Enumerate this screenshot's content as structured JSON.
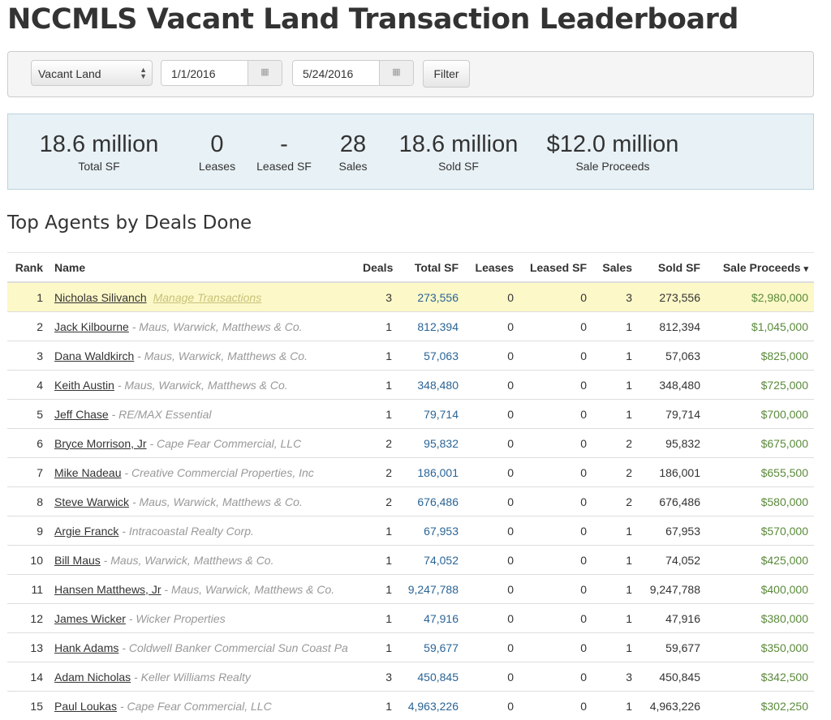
{
  "title": "NCCMLS Vacant Land Transaction Leaderboard",
  "filters": {
    "property_type": "Vacant Land",
    "start_date": "1/1/2016",
    "end_date": "5/24/2016",
    "filter_label": "Filter",
    "calendar_icon": "calendar-icon"
  },
  "stats": [
    {
      "value": "18.6 million",
      "label": "Total SF"
    },
    {
      "value": "0",
      "label": "Leases"
    },
    {
      "value": "-",
      "label": "Leased SF"
    },
    {
      "value": "28",
      "label": "Sales"
    },
    {
      "value": "18.6 million",
      "label": "Sold SF"
    },
    {
      "value": "$12.0 million",
      "label": "Sale Proceeds"
    }
  ],
  "section_title": "Top Agents by Deals Done",
  "table": {
    "headers": [
      "Rank",
      "Name",
      "Deals",
      "Total SF",
      "Leases",
      "Leased SF",
      "Sales",
      "Sold SF",
      "Sale Proceeds"
    ],
    "sort_indicator": "▾",
    "rows": [
      {
        "rank": "1",
        "name": "Nicholas Silivanch",
        "firm": "",
        "manage": "Manage Transactions",
        "deals": "3",
        "total_sf": "273,556",
        "leases": "0",
        "leased_sf": "0",
        "sales": "3",
        "sold_sf": "273,556",
        "proceeds": "$2,980,000"
      },
      {
        "rank": "2",
        "name": "Jack Kilbourne",
        "firm": "Maus, Warwick, Matthews & Co.",
        "deals": "1",
        "total_sf": "812,394",
        "leases": "0",
        "leased_sf": "0",
        "sales": "1",
        "sold_sf": "812,394",
        "proceeds": "$1,045,000"
      },
      {
        "rank": "3",
        "name": "Dana Waldkirch",
        "firm": "Maus, Warwick, Matthews & Co.",
        "deals": "1",
        "total_sf": "57,063",
        "leases": "0",
        "leased_sf": "0",
        "sales": "1",
        "sold_sf": "57,063",
        "proceeds": "$825,000"
      },
      {
        "rank": "4",
        "name": "Keith Austin",
        "firm": "Maus, Warwick, Matthews & Co.",
        "deals": "1",
        "total_sf": "348,480",
        "leases": "0",
        "leased_sf": "0",
        "sales": "1",
        "sold_sf": "348,480",
        "proceeds": "$725,000"
      },
      {
        "rank": "5",
        "name": "Jeff Chase",
        "firm": "RE/MAX Essential",
        "deals": "1",
        "total_sf": "79,714",
        "leases": "0",
        "leased_sf": "0",
        "sales": "1",
        "sold_sf": "79,714",
        "proceeds": "$700,000"
      },
      {
        "rank": "6",
        "name": "Bryce Morrison, Jr",
        "firm": "Cape Fear Commercial, LLC",
        "deals": "2",
        "total_sf": "95,832",
        "leases": "0",
        "leased_sf": "0",
        "sales": "2",
        "sold_sf": "95,832",
        "proceeds": "$675,000"
      },
      {
        "rank": "7",
        "name": "Mike Nadeau",
        "firm": "Creative Commercial Properties, Inc",
        "deals": "2",
        "total_sf": "186,001",
        "leases": "0",
        "leased_sf": "0",
        "sales": "2",
        "sold_sf": "186,001",
        "proceeds": "$655,500"
      },
      {
        "rank": "8",
        "name": "Steve Warwick",
        "firm": "Maus, Warwick, Matthews & Co.",
        "deals": "2",
        "total_sf": "676,486",
        "leases": "0",
        "leased_sf": "0",
        "sales": "2",
        "sold_sf": "676,486",
        "proceeds": "$580,000"
      },
      {
        "rank": "9",
        "name": "Argie Franck",
        "firm": "Intracoastal Realty Corp.",
        "deals": "1",
        "total_sf": "67,953",
        "leases": "0",
        "leased_sf": "0",
        "sales": "1",
        "sold_sf": "67,953",
        "proceeds": "$570,000"
      },
      {
        "rank": "10",
        "name": "Bill Maus",
        "firm": "Maus, Warwick, Matthews & Co.",
        "deals": "1",
        "total_sf": "74,052",
        "leases": "0",
        "leased_sf": "0",
        "sales": "1",
        "sold_sf": "74,052",
        "proceeds": "$425,000"
      },
      {
        "rank": "11",
        "name": "Hansen Matthews, Jr",
        "firm": "Maus, Warwick, Matthews & Co.",
        "deals": "1",
        "total_sf": "9,247,788",
        "leases": "0",
        "leased_sf": "0",
        "sales": "1",
        "sold_sf": "9,247,788",
        "proceeds": "$400,000"
      },
      {
        "rank": "12",
        "name": "James Wicker",
        "firm": "Wicker Properties",
        "deals": "1",
        "total_sf": "47,916",
        "leases": "0",
        "leased_sf": "0",
        "sales": "1",
        "sold_sf": "47,916",
        "proceeds": "$380,000"
      },
      {
        "rank": "13",
        "name": "Hank Adams",
        "firm": "Coldwell Banker Commercial Sun Coast Pa",
        "deals": "1",
        "total_sf": "59,677",
        "leases": "0",
        "leased_sf": "0",
        "sales": "1",
        "sold_sf": "59,677",
        "proceeds": "$350,000"
      },
      {
        "rank": "14",
        "name": "Adam Nicholas",
        "firm": "Keller Williams Realty",
        "deals": "3",
        "total_sf": "450,845",
        "leases": "0",
        "leased_sf": "0",
        "sales": "3",
        "sold_sf": "450,845",
        "proceeds": "$342,500"
      },
      {
        "rank": "15",
        "name": "Paul Loukas",
        "firm": "Cape Fear Commercial, LLC",
        "deals": "1",
        "total_sf": "4,963,226",
        "leases": "0",
        "leased_sf": "0",
        "sales": "1",
        "sold_sf": "4,963,226",
        "proceeds": "$302,250"
      }
    ]
  },
  "colors": {
    "highlight": "#fcf8c8",
    "link_blue": "#2a6496",
    "proceeds_green": "#5a8a3a",
    "stats_bg": "#e8f1f5"
  }
}
